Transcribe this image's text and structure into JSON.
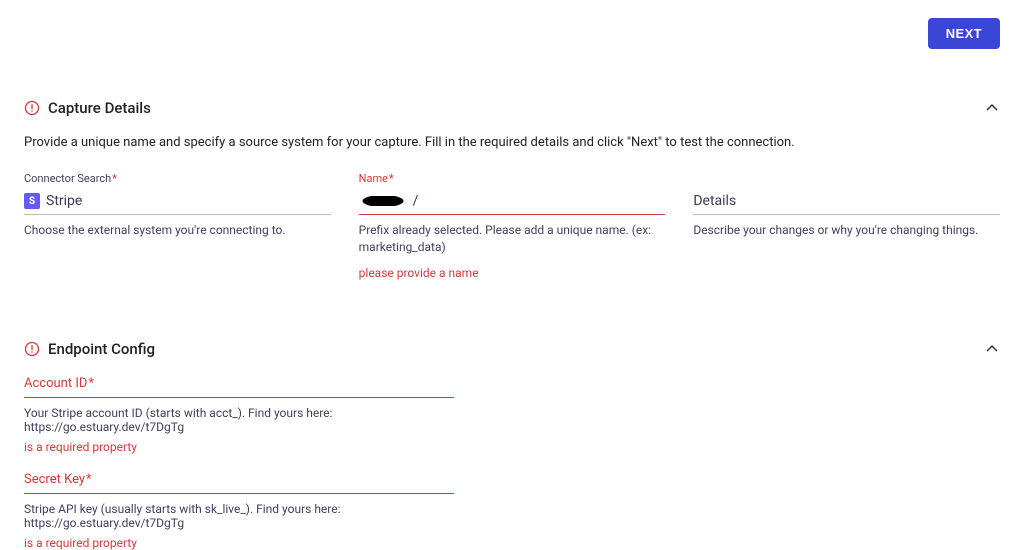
{
  "actions": {
    "next_label": "NEXT"
  },
  "colors": {
    "primary": "#3b45d6",
    "error": "#d03a3a",
    "text_muted": "#3f3f5f"
  },
  "capture": {
    "title": "Capture Details",
    "description": "Provide a unique name and specify a source system for your capture. Fill in the required details and click \"Next\" to test the connection.",
    "connector": {
      "label": "Connector Search",
      "required_marker": "*",
      "icon_name": "stripe-logo",
      "value": "Stripe",
      "help": "Choose the external system you're connecting to."
    },
    "name": {
      "label": "Name",
      "required_marker": "*",
      "value_suffix": "/",
      "help": "Prefix already selected. Please add a unique name. (ex: marketing_data)",
      "error": "please provide a name"
    },
    "details": {
      "label": "Details",
      "placeholder": "",
      "help": "Describe your changes or why you're changing things."
    }
  },
  "endpoint": {
    "title": "Endpoint Config",
    "account_id": {
      "label": "Account ID",
      "required_marker": "*",
      "help": "Your Stripe account ID (starts with acct_). Find yours here: https://go.estuary.dev/t7DgTg",
      "error": "is a required property"
    },
    "secret_key": {
      "label": "Secret Key",
      "required_marker": "*",
      "help": "Stripe API key (usually starts with sk_live_). Find yours here: https://go.estuary.dev/t7DgTg",
      "error": "is a required property"
    }
  }
}
